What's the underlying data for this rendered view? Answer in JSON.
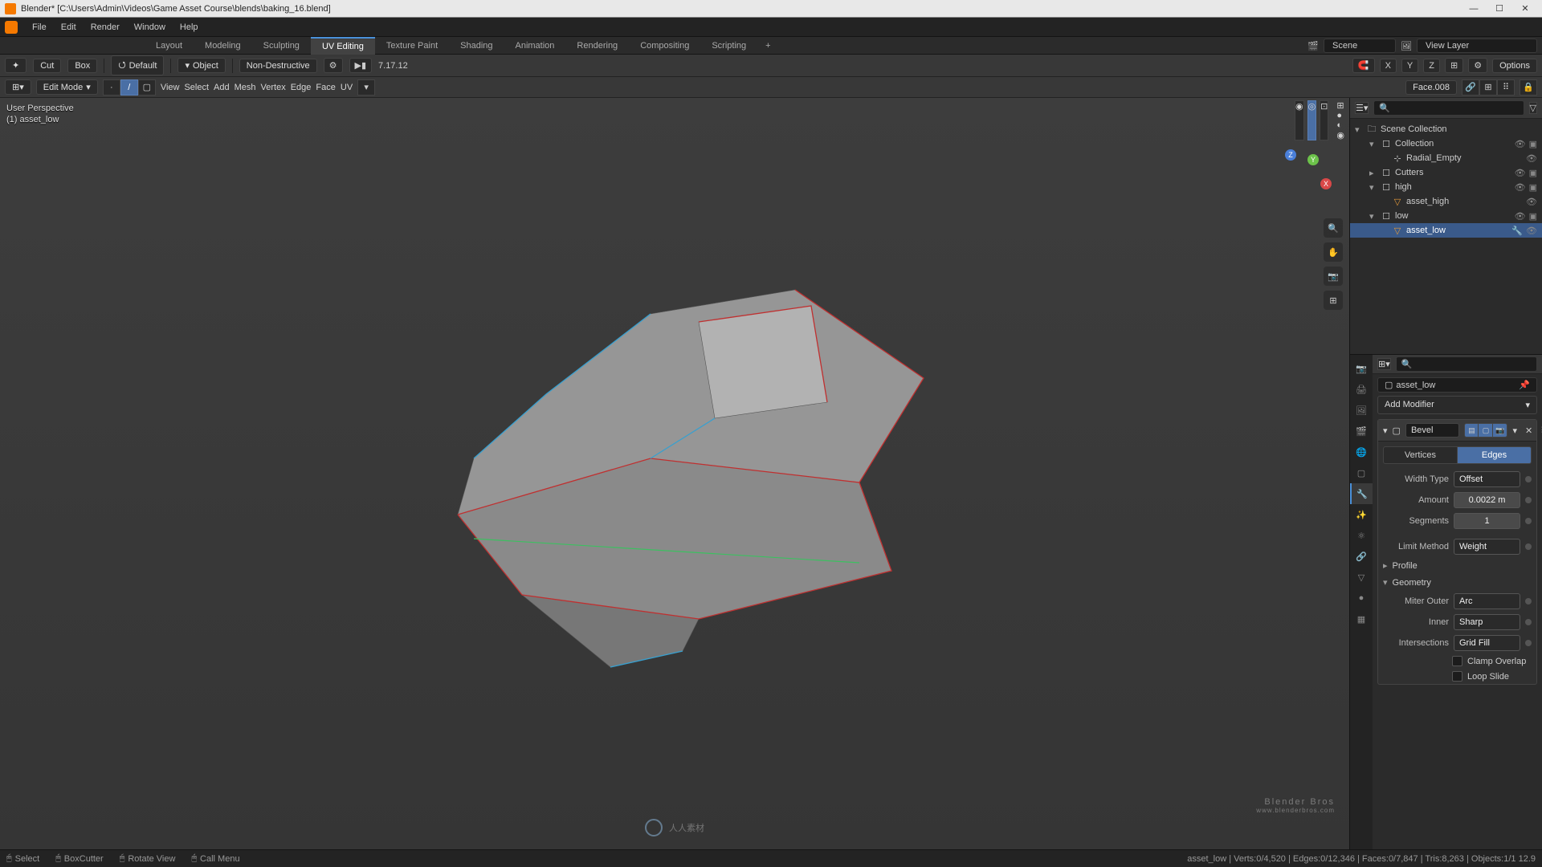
{
  "title": "Blender* [C:\\Users\\Admin\\Videos\\Game Asset Course\\blends\\baking_16.blend]",
  "menu": {
    "file": "File",
    "edit": "Edit",
    "render": "Render",
    "window": "Window",
    "help": "Help"
  },
  "workspaces": {
    "tabs": [
      "Layout",
      "Modeling",
      "Sculpting",
      "UV Editing",
      "Texture Paint",
      "Shading",
      "Animation",
      "Rendering",
      "Compositing",
      "Scripting"
    ],
    "active": "UV Editing",
    "scene_label": "Scene",
    "viewlayer_label": "View Layer"
  },
  "toolheader": {
    "tool": "Cut",
    "box": "Box",
    "default": "Default",
    "mode": "Object",
    "destructive": "Non-Destructive",
    "time": "7.17.12",
    "options": "Options",
    "overlay": "Overlays"
  },
  "toolheader2": {
    "mode": "Edit Mode",
    "view": "View",
    "select": "Select",
    "add": "Add",
    "mesh": "Mesh",
    "vertex": "Vertex",
    "edge": "Edge",
    "face": "Face",
    "uv": "UV",
    "face_field": "Face.008"
  },
  "viewport": {
    "persp": "User Perspective",
    "obj": "(1) asset_low"
  },
  "outliner": {
    "root": "Scene Collection",
    "items": [
      {
        "indent": 1,
        "expand": "▾",
        "icon": "□",
        "label": "Collection"
      },
      {
        "indent": 2,
        "expand": " ",
        "icon": "⊹",
        "label": "Radial_Empty"
      },
      {
        "indent": 1,
        "expand": "▸",
        "icon": "□",
        "label": "Cutters"
      },
      {
        "indent": 1,
        "expand": "▾",
        "icon": "□",
        "label": "high"
      },
      {
        "indent": 2,
        "expand": " ",
        "icon": "▽",
        "label": "asset_high"
      },
      {
        "indent": 1,
        "expand": "▾",
        "icon": "□",
        "label": "low"
      },
      {
        "indent": 2,
        "expand": " ",
        "icon": "▽",
        "label": "asset_low",
        "sel": true
      }
    ]
  },
  "properties": {
    "crumb": "asset_low",
    "add_modifier": "Add Modifier",
    "modifier": {
      "name": "Bevel",
      "vertices": "Vertices",
      "edges": "Edges",
      "width_type_lbl": "Width Type",
      "width_type": "Offset",
      "amount_lbl": "Amount",
      "amount": "0.0022 m",
      "segments_lbl": "Segments",
      "segments": "1",
      "limit_lbl": "Limit Method",
      "limit": "Weight",
      "profile": "Profile",
      "geometry": "Geometry",
      "miter_outer_lbl": "Miter Outer",
      "miter_outer": "Arc",
      "inner_lbl": "Inner",
      "inner": "Sharp",
      "intersections_lbl": "Intersections",
      "intersections": "Grid Fill",
      "clamp": "Clamp Overlap",
      "loopslide": "Loop Slide"
    }
  },
  "statusbar": {
    "select": "Select",
    "boxcutter": "BoxCutter",
    "rotate": "Rotate View",
    "callmenu": "Call Menu",
    "stats": "asset_low | Verts:0/4,520 | Edges:0/12,346 | Faces:0/7,847 | Tris:8,263 | Objects:1/1 12.9"
  },
  "brand": {
    "main": "Blender Bros",
    "sub": "www.blenderbros.com"
  }
}
